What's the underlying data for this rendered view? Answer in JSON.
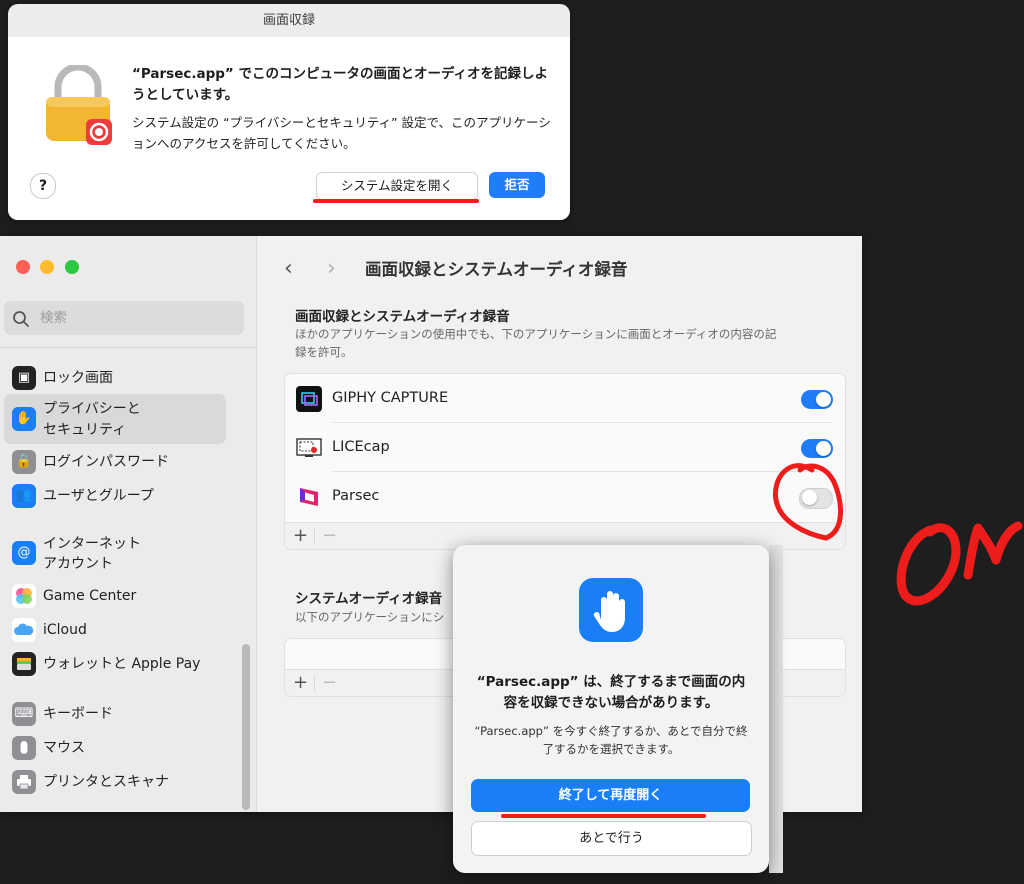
{
  "alert1": {
    "title": "画面収録",
    "heading": "“Parsec.app” でこのコンピュータの画面とオーディオを記録しようとしています。",
    "desc": "システム設定の “プライバシーとセキュリティ” 設定で、このアプリケーションへのアクセスを許可してください。",
    "help": "?",
    "open_settings": "システム設定を開く",
    "deny": "拒否"
  },
  "sidebar": {
    "search_placeholder": "検索",
    "items": [
      {
        "label": "ロック画面",
        "icon": "lock-screen-icon",
        "color": "#222222"
      },
      {
        "label": "プライバシーと",
        "label2": "セキュリティ",
        "icon": "hand-icon",
        "color": "#1a7ff6"
      },
      {
        "label": "ログインパスワード",
        "icon": "lock-icon",
        "color": "#8e8e93"
      },
      {
        "label": "ユーザとグループ",
        "icon": "users-icon",
        "color": "#1a7ff6"
      },
      {
        "label": "インターネット",
        "label2": "アカウント",
        "icon": "at-icon",
        "color": "#1a7ff6"
      },
      {
        "label": "Game Center",
        "icon": "game-center-icon",
        "color": "#ffffff"
      },
      {
        "label": "iCloud",
        "icon": "cloud-icon",
        "color": "#ffffff"
      },
      {
        "label": "ウォレットと Apple Pay",
        "icon": "wallet-icon",
        "color": "#222222"
      },
      {
        "label": "キーボード",
        "icon": "keyboard-icon",
        "color": "#8e8e93"
      },
      {
        "label": "マウス",
        "icon": "mouse-icon",
        "color": "#8e8e93"
      },
      {
        "label": "プリンタとスキャナ",
        "icon": "printer-icon",
        "color": "#8e8e93"
      }
    ]
  },
  "main": {
    "title": "画面収録とシステムオーディオ録音",
    "section1_title": "画面収録とシステムオーディオ録音",
    "section1_desc": "ほかのアプリケーションの使用中でも、下のアプリケーションに画面とオーディオの内容の記録を許可。",
    "apps": [
      {
        "name": "GIPHY CAPTURE",
        "enabled": true
      },
      {
        "name": "LICEcap",
        "enabled": true
      },
      {
        "name": "Parsec",
        "enabled": false
      }
    ],
    "section2_title": "システムオーディオ録音",
    "section2_desc": "以下のアプリケーションにシ",
    "plus": "+",
    "minus": "−"
  },
  "dialog2": {
    "title": "“Parsec.app” は、終了するまで画面の内容を収録できない場合があります。",
    "desc": "“Parsec.app” を今すぐ終了するか、あとで自分で終了するかを選択できます。",
    "quit_reopen": "終了して再度開く",
    "later": "あとで行う"
  },
  "annotation": {
    "handwritten_text": "on",
    "color": "#ef1c1c"
  },
  "colors": {
    "accent": "#1f7ef7",
    "annotation_red": "#ef1c1c"
  }
}
